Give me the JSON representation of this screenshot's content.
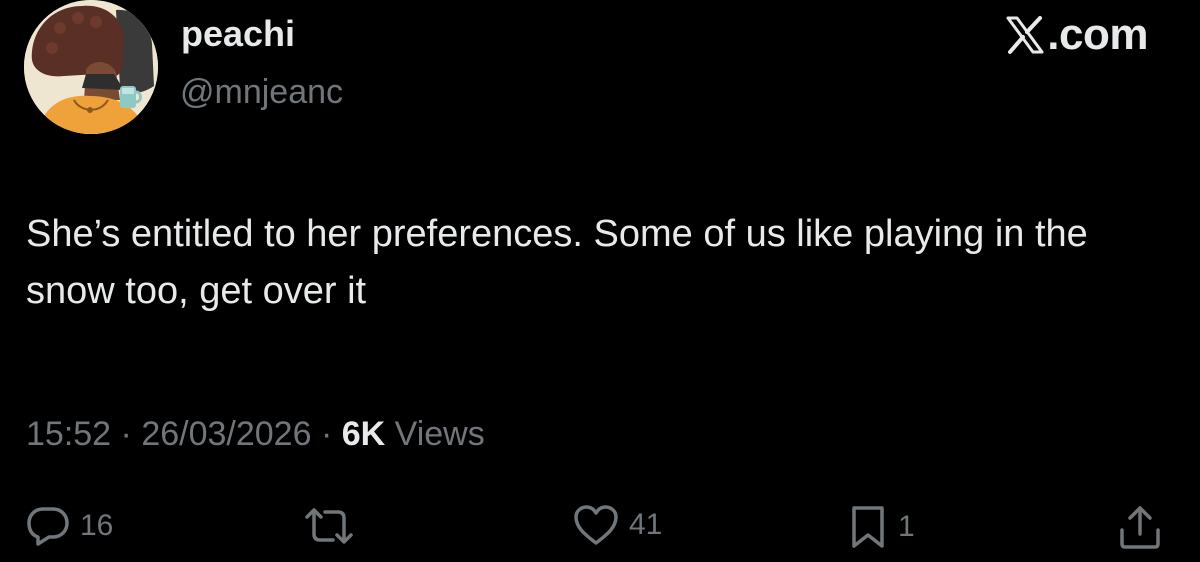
{
  "author": {
    "display_name": "peachi",
    "handle": "@mnjeanc",
    "avatar_icon": "avatar-illustration"
  },
  "brand": {
    "logo_icon": "x-logo-icon",
    "text": ".com"
  },
  "tweet": {
    "text": "She’s entitled to her preferences. Some of us like playing in the snow too, get over it",
    "time": "15:52",
    "separator_1": "·",
    "date": "26/03/2026",
    "separator_2": "·",
    "views_count": "6K",
    "views_label": "Views"
  },
  "actions": {
    "reply": {
      "icon": "reply-icon",
      "count": "16"
    },
    "repost": {
      "icon": "repost-icon",
      "count": ""
    },
    "like": {
      "icon": "heart-icon",
      "count": "41"
    },
    "bookmark": {
      "icon": "bookmark-icon",
      "count": "1"
    },
    "share": {
      "icon": "share-icon"
    }
  },
  "colors": {
    "background": "#000000",
    "primary_text": "#e7e9ea",
    "secondary_text": "#71767b"
  }
}
